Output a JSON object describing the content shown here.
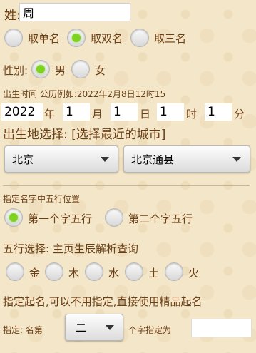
{
  "surname": {
    "label": "姓:",
    "value": "周"
  },
  "name_length": {
    "options": [
      {
        "label": "取单名",
        "selected": false
      },
      {
        "label": "取双名",
        "selected": true
      },
      {
        "label": "取三名",
        "selected": false
      }
    ]
  },
  "gender": {
    "label": "性别:",
    "options": [
      {
        "label": "男",
        "selected": true
      },
      {
        "label": "女",
        "selected": false
      }
    ]
  },
  "birth_time": {
    "hint": "出生时间 公历例如:2022年2月8日12时15",
    "year": {
      "value": "2022",
      "unit": "年"
    },
    "month": {
      "value": "1",
      "unit": "月"
    },
    "day": {
      "value": "1",
      "unit": "日"
    },
    "hour": {
      "value": "1",
      "unit": "时"
    },
    "minute": {
      "value": "1",
      "unit": "分"
    }
  },
  "birthplace": {
    "label": "出生地选择: [选择最近的城市]",
    "province": "北京",
    "city": "北京通县"
  },
  "element_position": {
    "label": "指定名字中五行位置",
    "options": [
      {
        "label": "第一个字五行",
        "selected": true
      },
      {
        "label": "第二个字五行",
        "selected": false
      }
    ]
  },
  "element_select": {
    "label": "五行选择: 主页生辰解析查询",
    "options": [
      {
        "label": "金",
        "selected": false
      },
      {
        "label": "木",
        "selected": false
      },
      {
        "label": "水",
        "selected": false
      },
      {
        "label": "土",
        "selected": false
      },
      {
        "label": "火",
        "selected": false
      }
    ]
  },
  "specify": {
    "note": "指定起名,可以不用指定,直接使用精品起名",
    "prefix": "指定: 名第",
    "position_value": "二",
    "suffix": "个字指定为",
    "char_value": ""
  },
  "colors": {
    "background": "#f4e7c9",
    "text": "#6b3e14",
    "radio_selected": "#7ed321"
  }
}
